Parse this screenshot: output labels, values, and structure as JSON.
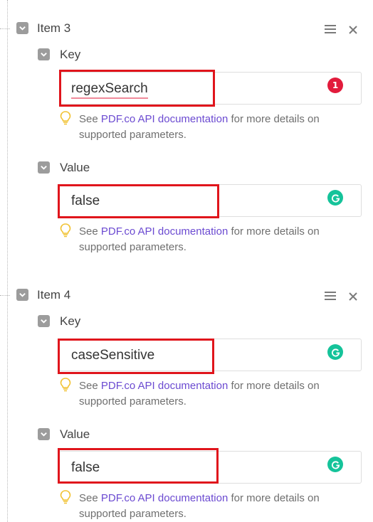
{
  "items": [
    {
      "title": "Item 3",
      "key": {
        "label": "Key",
        "value": "regexSearch",
        "spelling_issue_count": "1"
      },
      "value": {
        "label": "Value",
        "value": "false"
      }
    },
    {
      "title": "Item 4",
      "key": {
        "label": "Key",
        "value": "caseSensitive"
      },
      "value": {
        "label": "Value",
        "value": "false"
      }
    }
  ],
  "hint": {
    "prefix": "See ",
    "link": "PDF.co API documentation",
    "suffix": " for more details on supported parameters."
  },
  "icons": {
    "collapse": "chevron-down-icon",
    "menu": "hamburger-menu-icon",
    "remove": "close-icon",
    "hint": "lightbulb-icon",
    "grammar": "grammarly-icon"
  },
  "colors": {
    "highlight": "#e0151c",
    "link": "#6b4ad1",
    "grammarly": "#15c39a",
    "error_badge": "#e21b3c"
  }
}
